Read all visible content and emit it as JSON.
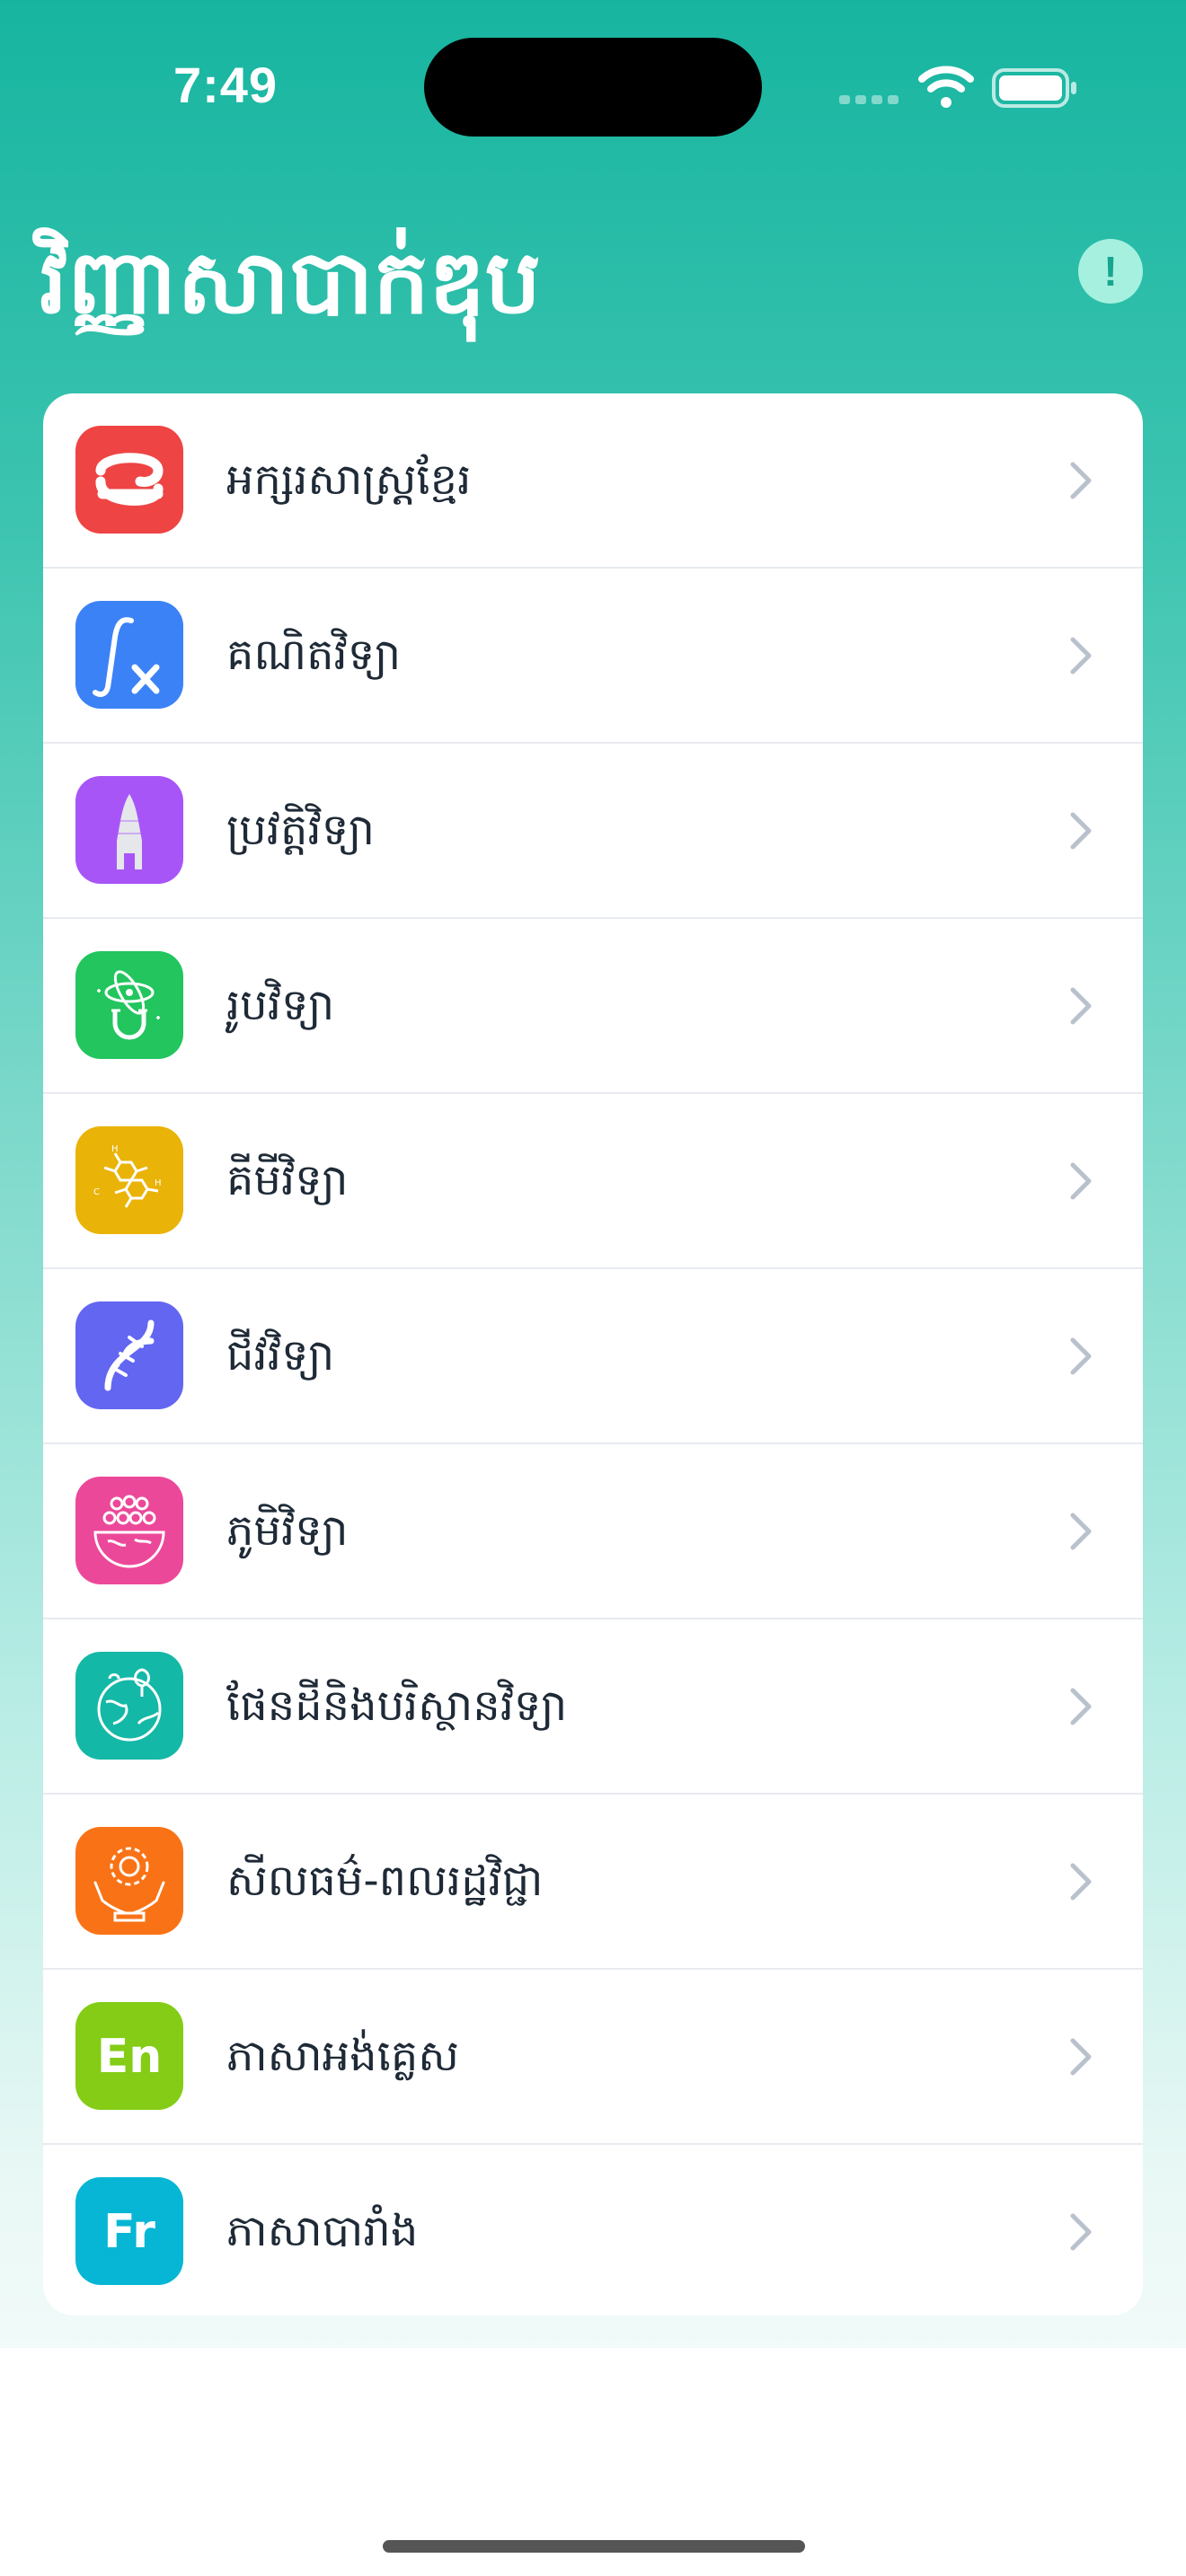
{
  "status_bar": {
    "time": "7:49"
  },
  "header": {
    "title": "វិញ្ញាសាបាក់ឌុប",
    "info_icon": "exclamation-icon"
  },
  "subjects": [
    {
      "label": "អក្សរសាស្ត្រខ្មែរ",
      "icon": "khmer-letter-icon",
      "color": "#ef4444"
    },
    {
      "label": "គណិតវិទ្យា",
      "icon": "function-fx-icon",
      "color": "#3b82f6"
    },
    {
      "label": "ប្រវត្តិវិទ្យា",
      "icon": "temple-tower-icon",
      "color": "#a855f7"
    },
    {
      "label": "រូបវិទ្យា",
      "icon": "atom-magnet-icon",
      "color": "#22c55e"
    },
    {
      "label": "គីមីវិទ្យា",
      "icon": "molecule-icon",
      "color": "#eab308"
    },
    {
      "label": "ជីវវិទ្យា",
      "icon": "dna-icon",
      "color": "#6366f1"
    },
    {
      "label": "ភូមិវិទ្យា",
      "icon": "globe-people-icon",
      "color": "#ec4899"
    },
    {
      "label": "ផែនដីនិងបរិស្ថានវិទ្យា",
      "icon": "earth-tree-icon",
      "color": "#14b8a6"
    },
    {
      "label": "សីលធម៌-ពលរដ្ឋវិជ្ជា",
      "icon": "hands-flower-icon",
      "color": "#f97316"
    },
    {
      "label": "ភាសាអង់គ្លេស",
      "icon": "english-icon",
      "icon_text": "En",
      "color": "#84cc16"
    },
    {
      "label": "ភាសាបារាំង",
      "icon": "french-icon",
      "icon_text": "Fr",
      "color": "#06b6d4"
    }
  ]
}
